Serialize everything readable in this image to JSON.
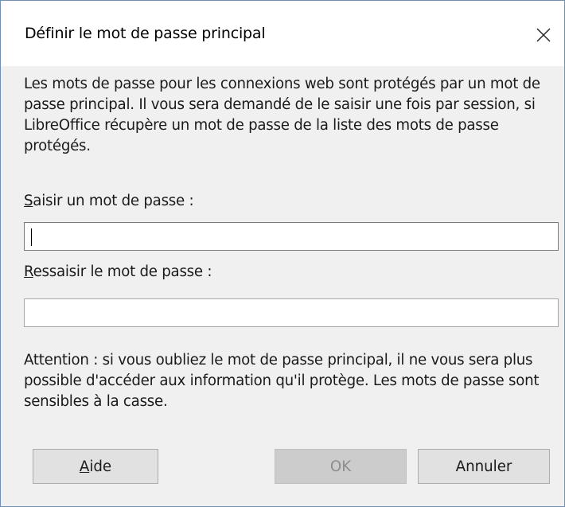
{
  "dialog": {
    "title": "Définir le mot de passe principal",
    "close_icon": "close-icon"
  },
  "description": "Les mots de passe pour les connexions web sont protégés par un mot de passe principal. Il vous sera demandé de le saisir une fois par session, si LibreOffice récupère un mot de passe de la liste des mots de passe protégés.",
  "password_field": {
    "label_mnemonic": "S",
    "label_rest": "aisir un mot de passe :",
    "value": ""
  },
  "confirm_field": {
    "label_mnemonic": "R",
    "label_rest": "essaisir le mot de passe :",
    "value": ""
  },
  "warning": "Attention : si vous oubliez le mot de passe principal, il ne vous sera plus possible d'accéder aux information qu'il protège. Les mots de passe sont sensibles à la casse.",
  "buttons": {
    "help_mnemonic": "A",
    "help_rest": "ide",
    "ok": "OK",
    "cancel": "Annuler"
  }
}
